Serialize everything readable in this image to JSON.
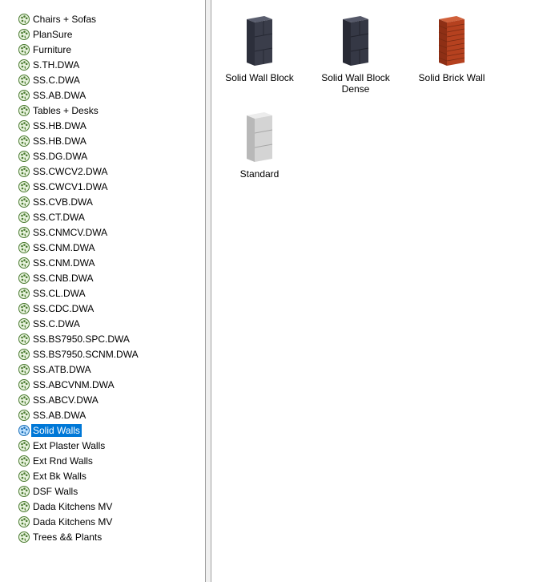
{
  "tree": {
    "items": [
      {
        "label": "Chairs + Sofas"
      },
      {
        "label": "PlanSure"
      },
      {
        "label": "Furniture"
      },
      {
        "label": "S.TH.DWA"
      },
      {
        "label": "SS.C.DWA"
      },
      {
        "label": "SS.AB.DWA"
      },
      {
        "label": "Tables + Desks"
      },
      {
        "label": "SS.HB.DWA"
      },
      {
        "label": "SS.HB.DWA"
      },
      {
        "label": "SS.DG.DWA"
      },
      {
        "label": "SS.CWCV2.DWA"
      },
      {
        "label": "SS.CWCV1.DWA"
      },
      {
        "label": "SS.CVB.DWA"
      },
      {
        "label": "SS.CT.DWA"
      },
      {
        "label": "SS.CNMCV.DWA"
      },
      {
        "label": "SS.CNM.DWA"
      },
      {
        "label": "SS.CNM.DWA"
      },
      {
        "label": "SS.CNB.DWA"
      },
      {
        "label": "SS.CL.DWA"
      },
      {
        "label": "SS.CDC.DWA"
      },
      {
        "label": "SS.C.DWA"
      },
      {
        "label": "SS.BS7950.SPC.DWA"
      },
      {
        "label": "SS.BS7950.SCNM.DWA"
      },
      {
        "label": "SS.ATB.DWA"
      },
      {
        "label": "SS.ABCVNM.DWA"
      },
      {
        "label": "SS.ABCV.DWA"
      },
      {
        "label": "SS.AB.DWA"
      },
      {
        "label": "Solid Walls",
        "selected": true
      },
      {
        "label": "Ext Plaster Walls"
      },
      {
        "label": "Ext Rnd Walls"
      },
      {
        "label": "Ext Bk Walls"
      },
      {
        "label": "DSF Walls"
      },
      {
        "label": "Dada Kitchens MV"
      },
      {
        "label": "Dada Kitchens MV"
      },
      {
        "label": "Trees && Plants"
      }
    ],
    "icon": "palette-icon",
    "selected_color": "#0078d7"
  },
  "tiles": [
    {
      "label": "Solid Wall Block",
      "line2": "",
      "icon": "wall-block-icon",
      "color": "#3a3d4a"
    },
    {
      "label": "Solid Wall Block",
      "line2": "Dense",
      "icon": "wall-block-dense-icon",
      "color": "#353845"
    },
    {
      "label": "Solid Brick Wall",
      "line2": "",
      "icon": "brick-wall-icon",
      "color": "#b5411f"
    },
    {
      "label": "Standard",
      "line2": "",
      "icon": "standard-wall-icon",
      "color": "#d4d4d4"
    }
  ]
}
